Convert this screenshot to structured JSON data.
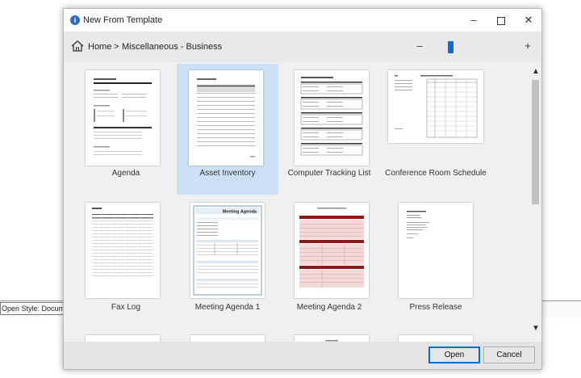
{
  "background": {
    "style_box_text": "Open Style: Docume"
  },
  "window": {
    "title": "New From Template",
    "controls": {
      "minimize": "–",
      "close": "✕"
    }
  },
  "nav": {
    "home_label": "Home",
    "separator": ">",
    "current_path": "Miscellaneous - Business",
    "zoom_minus": "–",
    "zoom_plus": "+"
  },
  "templates": [
    {
      "label": "Agenda",
      "selected": false
    },
    {
      "label": "Asset Inventory",
      "selected": true
    },
    {
      "label": "Computer Tracking List",
      "selected": false
    },
    {
      "label": "Conference Room Schedule",
      "selected": false
    },
    {
      "label": "Fax Log",
      "selected": false
    },
    {
      "label": "Meeting Agenda 1",
      "selected": false
    },
    {
      "label": "Meeting Agenda 2",
      "selected": false
    },
    {
      "label": "Press Release",
      "selected": false
    }
  ],
  "thumb_text": {
    "meeting_agenda_1_header": "Meeting Agenda"
  },
  "scroll": {
    "up": "▲",
    "down": "▼"
  },
  "buttons": {
    "open": "Open",
    "cancel": "Cancel"
  },
  "colors": {
    "accent": "#0f6cce",
    "selection": "#cce0f5",
    "agenda2_red": "#8b1a1a"
  }
}
